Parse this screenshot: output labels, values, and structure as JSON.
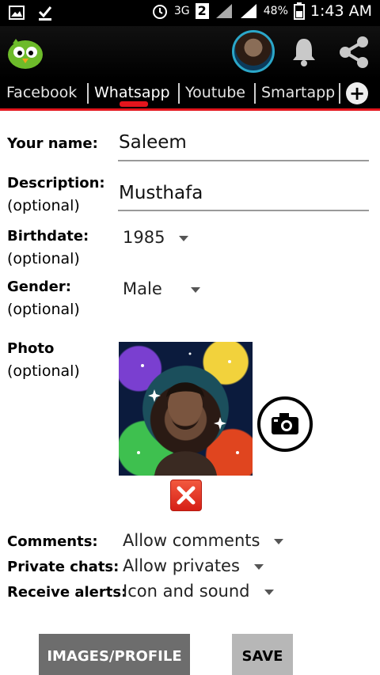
{
  "status_bar": {
    "network": "3G",
    "sim": "2",
    "battery": "48%",
    "time": "1:43 AM"
  },
  "app_bar": {
    "logo_icon": "green-bird-logo-icon",
    "avatar_icon": "profile-avatar",
    "notification_icon": "bell-icon",
    "share_icon": "share-icon"
  },
  "tabs": {
    "items": [
      {
        "label": "Facebook"
      },
      {
        "label": "Whatsapp"
      },
      {
        "label": "Youtube"
      },
      {
        "label": "Smartapp"
      }
    ],
    "active": "Whatsapp",
    "add_icon": "plus-circle-icon",
    "accent_color": "#e3151d"
  },
  "form": {
    "name": {
      "label": "Your name:",
      "value": "Saleem"
    },
    "description": {
      "label": "Description:",
      "optional": "(optional)",
      "value": "Musthafa"
    },
    "birthdate": {
      "label": "Birthdate:",
      "optional": "(optional)",
      "value": "1985"
    },
    "gender": {
      "label": "Gender:",
      "optional": "(optional)",
      "value": "Male"
    },
    "photo": {
      "label": "Photo",
      "optional": "(optional)",
      "camera_icon": "camera-icon",
      "delete_icon": "close-icon"
    },
    "comments": {
      "label": "Comments:",
      "value": "Allow comments"
    },
    "private_chats": {
      "label": "Private chats:",
      "value": "Allow privates"
    },
    "receive_alerts": {
      "label": "Receive alerts:",
      "value": "Icon and sound"
    }
  },
  "buttons": {
    "images_profile": "IMAGES/PROFILE",
    "save": "SAVE"
  }
}
